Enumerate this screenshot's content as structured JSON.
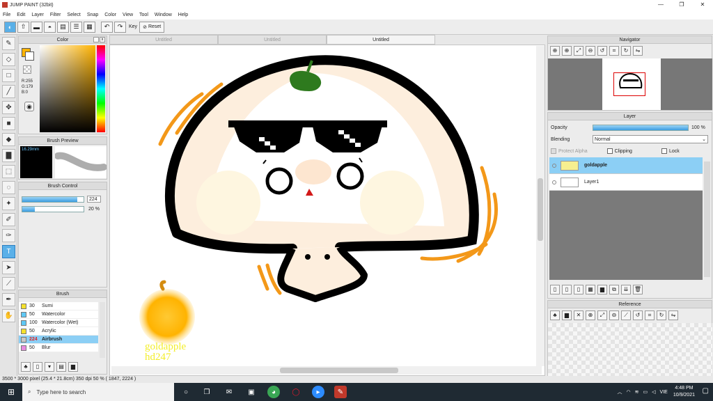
{
  "title": "JUMP PAINT (32bit)",
  "window_controls": [
    "—",
    "❐",
    "✕"
  ],
  "menu": [
    "File",
    "Edit",
    "Layer",
    "Filter",
    "Select",
    "Snap",
    "Color",
    "View",
    "Tool",
    "Window",
    "Help"
  ],
  "toolbar": {
    "key_label": "Key",
    "reset_label": "Reset"
  },
  "tabs": [
    "Untitled",
    "Untitled",
    "Untitled"
  ],
  "color_panel": {
    "title": "Color",
    "r": "R:255",
    "g": "G:179",
    "b": "B:0",
    "fg": "#ffb300"
  },
  "brush_preview": {
    "title": "Brush Preview",
    "size": "16.29mm"
  },
  "brush_control": {
    "title": "Brush Control",
    "size_value": "224",
    "size_fraction": 0.9,
    "opacity_value": "20 %",
    "opacity_fraction": 0.2
  },
  "brush_panel": {
    "title": "Brush",
    "items": [
      {
        "num": "30",
        "name": "Sumi",
        "color": "#f5e12c"
      },
      {
        "num": "50",
        "name": "Watercolor",
        "color": "#5fc8f5"
      },
      {
        "num": "100",
        "name": "Watercolor (Wet)",
        "color": "#5fc8f5"
      },
      {
        "num": "50",
        "name": "Acrylic",
        "color": "#f5e12c"
      },
      {
        "num": "224",
        "name": "Airbrush",
        "color": "#c8c8c8"
      },
      {
        "num": "50",
        "name": "Blur",
        "color": "#e78be0"
      }
    ]
  },
  "navigator": {
    "title": "Navigator"
  },
  "layer_panel": {
    "title": "Layer",
    "opacity_label": "Opacity",
    "opacity_value": "100 %",
    "opacity_fraction": 1.0,
    "blending_label": "Blending",
    "blending_value": "Normal",
    "protect_alpha": "Protect Alpha",
    "clipping": "Clipping",
    "lock": "Lock",
    "layers": [
      {
        "name": "goldapple",
        "selected": true
      },
      {
        "name": "Layer1",
        "selected": false
      }
    ]
  },
  "reference_panel": {
    "title": "Reference"
  },
  "canvas": {
    "signature_line1": "goldapple",
    "signature_line2": "hd247"
  },
  "status": "3500 * 3000 pixel   (25.4 * 21.8cm)   350 dpi   50 %   ( 1847, 2224 )",
  "taskbar": {
    "search_placeholder": "Type here to search",
    "language": "VIE",
    "time": "4:48 PM",
    "date": "10/9/2021"
  }
}
